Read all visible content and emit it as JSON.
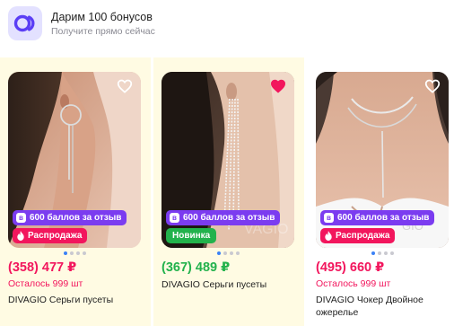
{
  "promo": {
    "title": "Дарим 100 бонусов",
    "subtitle": "Получите прямо сейчас",
    "icon": "bonus-logo-icon",
    "icon_color": "#5b3ef5"
  },
  "colors": {
    "sale_price": "#f2165d",
    "new_price": "#22b24c",
    "review_badge": "#7b3cf0",
    "sale_badge": "#f2165d",
    "new_badge": "#22b24c",
    "highlight_bg": "#fffbe3"
  },
  "products": [
    {
      "badge_review": "600 баллов за отзыв",
      "badge_tag": "Распродажа",
      "price": "(358) 477 ₽",
      "stock": "Осталось 999 шт",
      "name": "DIVAGIO Серьги пусеты",
      "favorite": false
    },
    {
      "badge_review": "600 баллов за отзыв",
      "badge_tag": "Новинка",
      "price": "(367) 489 ₽",
      "stock": "",
      "name": "DIVAGIO Серьги пусеты",
      "favorite": true
    },
    {
      "badge_review": "600 баллов за отзыв",
      "badge_tag": "Распродажа",
      "price": "(495) 660 ₽",
      "stock": "Осталось 999 шт",
      "name": "DIVAGIO Чокер Двойное ожерелье",
      "favorite": false
    }
  ]
}
